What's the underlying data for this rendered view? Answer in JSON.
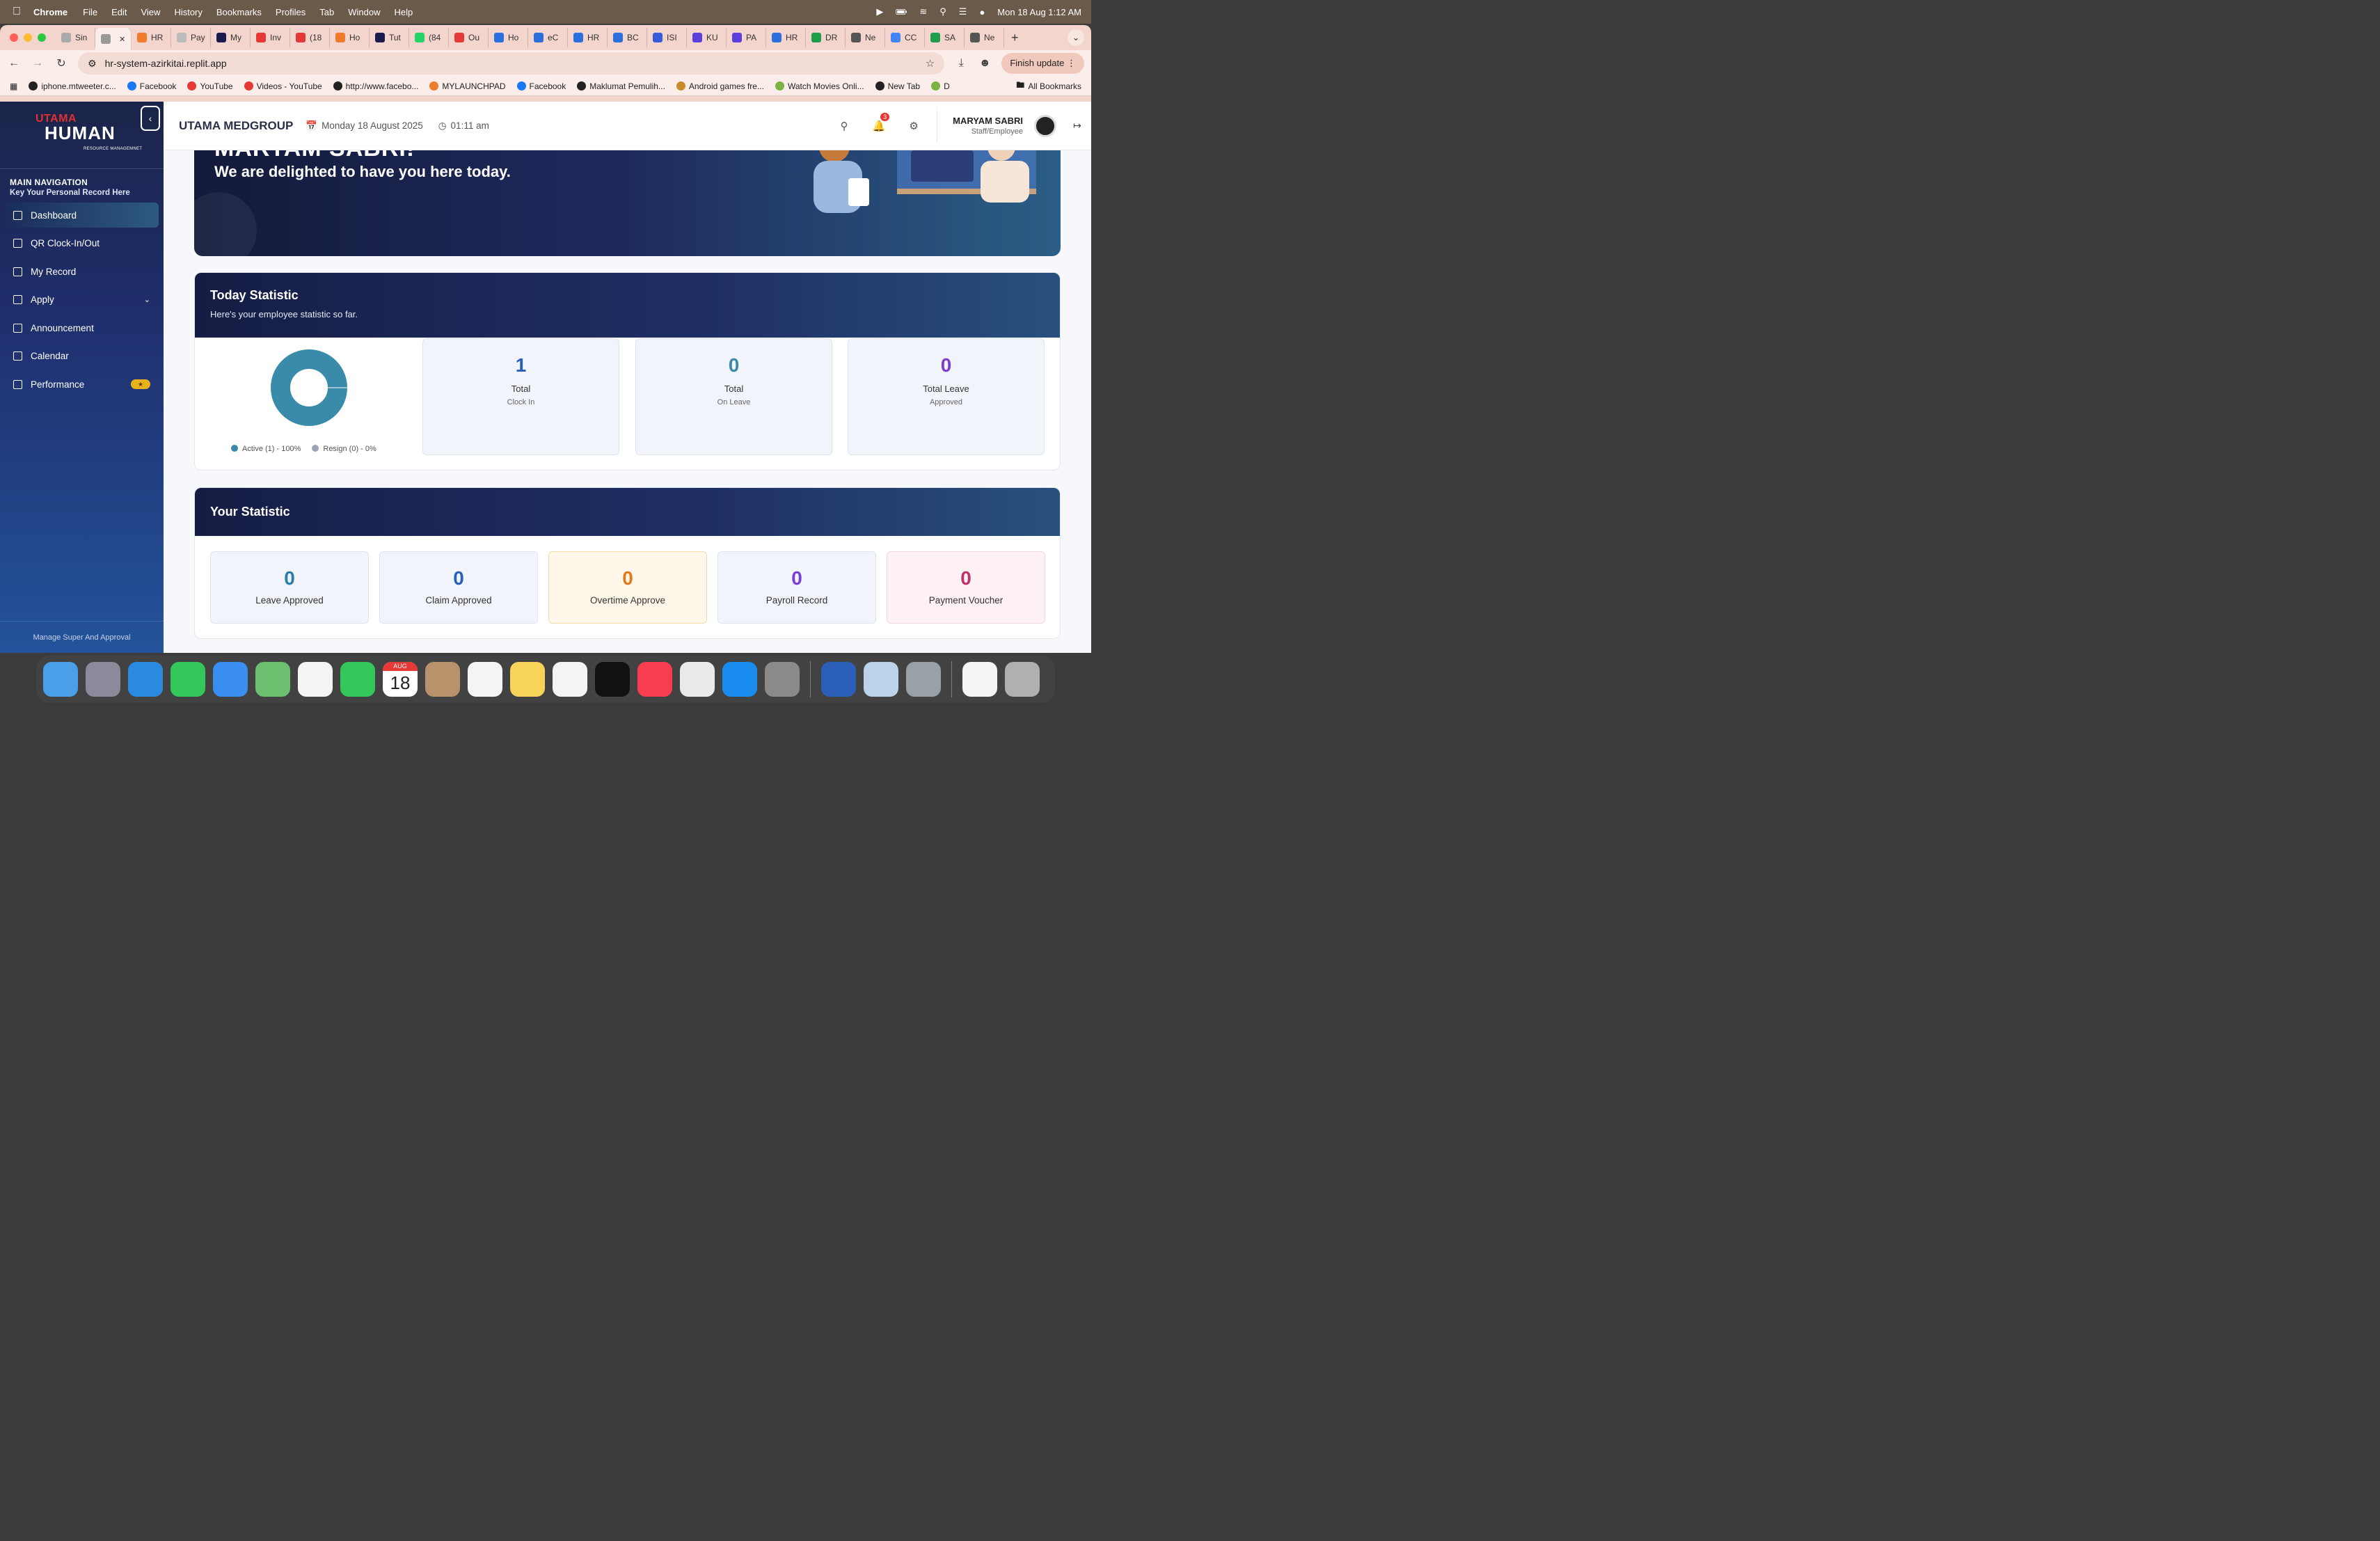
{
  "menubar": {
    "app": "Chrome",
    "items": [
      "File",
      "Edit",
      "View",
      "History",
      "Bookmarks",
      "Profiles",
      "Tab",
      "Window",
      "Help"
    ],
    "datetime": "Mon 18 Aug  1:12 AM"
  },
  "tabs": [
    {
      "label": "Sin",
      "color": "#aaaaaa"
    },
    {
      "label": "",
      "color": "#999999",
      "active": true
    },
    {
      "label": "HR",
      "color": "#f07b2a"
    },
    {
      "label": "Pay",
      "color": "#bbbbbb"
    },
    {
      "label": "My",
      "color": "#1a1a4e"
    },
    {
      "label": "Inv",
      "color": "#e53935"
    },
    {
      "label": "(18",
      "color": "#e53935"
    },
    {
      "label": "Ho",
      "color": "#f07b2a"
    },
    {
      "label": "Tut",
      "color": "#1a1a4e"
    },
    {
      "label": "(84",
      "color": "#25d366"
    },
    {
      "label": "Ou",
      "color": "#e53935"
    },
    {
      "label": "Ho",
      "color": "#2a6fdb"
    },
    {
      "label": "eC",
      "color": "#2a6fdb"
    },
    {
      "label": "HR",
      "color": "#2a6fdb"
    },
    {
      "label": "BC",
      "color": "#2a6fdb"
    },
    {
      "label": "ISI",
      "color": "#3a5bd9"
    },
    {
      "label": "KU",
      "color": "#5a3fd9"
    },
    {
      "label": "PA",
      "color": "#5a3fd9"
    },
    {
      "label": "HR",
      "color": "#2a6fdb"
    },
    {
      "label": "DR",
      "color": "#1e9e4a"
    },
    {
      "label": "Ne",
      "color": "#555555"
    },
    {
      "label": "CC",
      "color": "#4285f4"
    },
    {
      "label": "SA",
      "color": "#1e9e4a"
    },
    {
      "label": "Ne",
      "color": "#555555"
    }
  ],
  "omnibox": {
    "url": "hr-system-azirkitai.replit.app",
    "finish_update": "Finish update"
  },
  "bookmarks": [
    {
      "label": "iphone.mtweeter.c...",
      "color": "#222222"
    },
    {
      "label": "Facebook",
      "color": "#1877f2"
    },
    {
      "label": "YouTube",
      "color": "#e53935"
    },
    {
      "label": "Videos - YouTube",
      "color": "#e53935"
    },
    {
      "label": "http://www.facebo...",
      "color": "#222222"
    },
    {
      "label": "MYLAUNCHPAD",
      "color": "#f07b2a"
    },
    {
      "label": "Facebook",
      "color": "#1877f2"
    },
    {
      "label": "Maklumat Pemulih...",
      "color": "#222222"
    },
    {
      "label": "Android games fre...",
      "color": "#c98a2a"
    },
    {
      "label": "Watch Movies Onli...",
      "color": "#7cb342"
    },
    {
      "label": "New Tab",
      "color": "#222222"
    },
    {
      "label": "D",
      "color": "#7cb342"
    }
  ],
  "bookmarks_all": "All Bookmarks",
  "sidebar": {
    "logo_top": "UTAMA",
    "logo_main": "HUMAN",
    "logo_sub": "RESOURCE MANAGEMNET",
    "nav_title": "MAIN NAVIGATION",
    "nav_subtitle": "Key Your Personal Record Here",
    "items": [
      {
        "label": "Dashboard",
        "icon": "dashboard-icon"
      },
      {
        "label": "QR Clock-In/Out",
        "icon": "qr-icon"
      },
      {
        "label": "My Record",
        "icon": "record-icon"
      },
      {
        "label": "Apply",
        "icon": "apply-icon"
      },
      {
        "label": "Announcement",
        "icon": "megaphone-icon"
      },
      {
        "label": "Calendar",
        "icon": "calendar-icon"
      },
      {
        "label": "Performance",
        "icon": "trend-icon"
      }
    ],
    "footer": "Manage Super And Approval"
  },
  "topbar": {
    "company": "UTAMA MEDGROUP",
    "date": "Monday 18 August 2025",
    "time": "01:11 am",
    "notif_count": "3",
    "user_name": "MARYAM SABRI",
    "user_role": "Staff/Employee"
  },
  "hero": {
    "name": "MARYAM SABRI!",
    "subtitle": "We are delighted to have you here today."
  },
  "today": {
    "title": "Today Statistic",
    "subtitle": "Here's your employee statistic so far.",
    "legend": [
      {
        "label": "Active (1) - 100%",
        "color": "#3a8aaa"
      },
      {
        "label": "Resign (0) - 0%",
        "color": "#9aa3b5"
      }
    ],
    "donut": {
      "active_fraction": 1.0,
      "color": "#3a8aaa"
    },
    "stats": [
      {
        "num": "1",
        "l1": "Total",
        "l2": "Clock In",
        "color": "#2a5fb8"
      },
      {
        "num": "0",
        "l1": "Total",
        "l2": "On Leave",
        "color": "#3a8aaa"
      },
      {
        "num": "0",
        "l1": "Total Leave",
        "l2": "Approved",
        "color": "#7a3fd0"
      }
    ]
  },
  "yours": {
    "title": "Your Statistic",
    "stats": [
      {
        "num": "0",
        "label": "Leave Approved",
        "color": "#2a7fa8",
        "bg": "#f1f4fa",
        "border": "#dfe5ef"
      },
      {
        "num": "0",
        "label": "Claim Approved",
        "color": "#2a5fb8",
        "bg": "#f1f4fa",
        "border": "#dfe5ef"
      },
      {
        "num": "0",
        "label": "Overtime Approve",
        "color": "#e07a1a",
        "bg": "#fff8ea",
        "border": "#f5d9a8"
      },
      {
        "num": "0",
        "label": "Payroll Record",
        "color": "#7a3fd0",
        "bg": "#f1f4fa",
        "border": "#dfe5ef"
      },
      {
        "num": "0",
        "label": "Payment Voucher",
        "color": "#c0306a",
        "bg": "#fdf1f4",
        "border": "#f3d5de"
      }
    ]
  },
  "dock": {
    "calendar_month": "AUG",
    "calendar_day": "18",
    "apps": [
      "finder-icon",
      "launchpad-icon",
      "safari-icon",
      "messages-icon",
      "mail-icon",
      "maps-icon",
      "photos-icon",
      "facetime-icon",
      "calendar-icon",
      "contacts-icon",
      "reminders-icon",
      "notes-icon",
      "freeform-icon",
      "tv-icon",
      "music-icon",
      "chrome-icon",
      "appstore-icon",
      "settings-icon",
      "word-icon",
      "preview-icon",
      "iphone-mirroring-icon",
      "document-icon",
      "trash-icon"
    ]
  }
}
